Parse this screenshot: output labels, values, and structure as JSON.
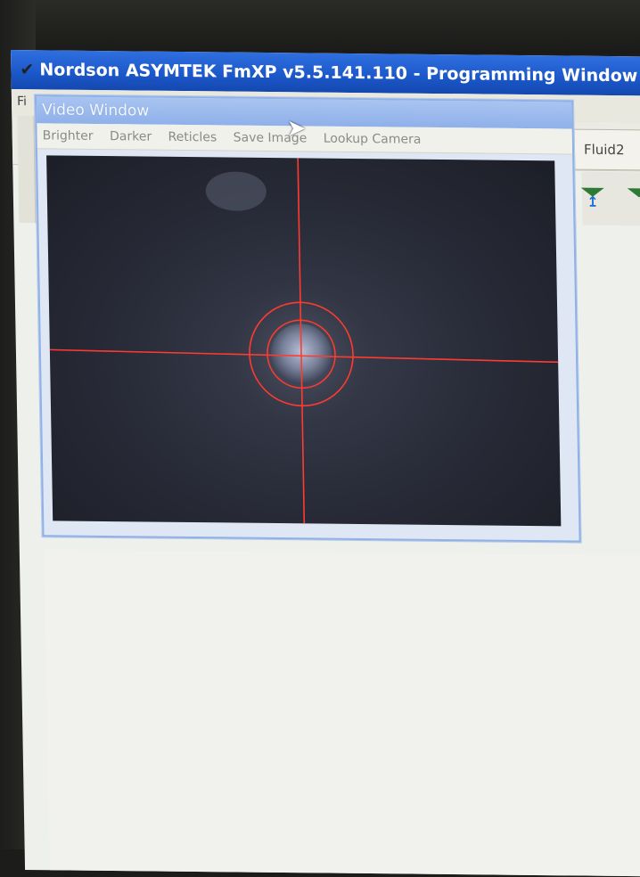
{
  "main_window": {
    "title": "Nordson ASYMTEK FmXP v5.5.141.110 - Programming Window",
    "menu_partial": "Fi",
    "fluid_label": "Fluid2"
  },
  "video_window": {
    "title": "Video Window",
    "menu": [
      "Brighter",
      "Darker",
      "Reticles",
      "Save Image",
      "Lookup Camera"
    ]
  },
  "camera_view": {
    "reticle_color": "#ff3b30",
    "reticle_rings": 2
  },
  "icons": {
    "app": "app-icon",
    "cursor": "mouse-pointer-icon"
  }
}
